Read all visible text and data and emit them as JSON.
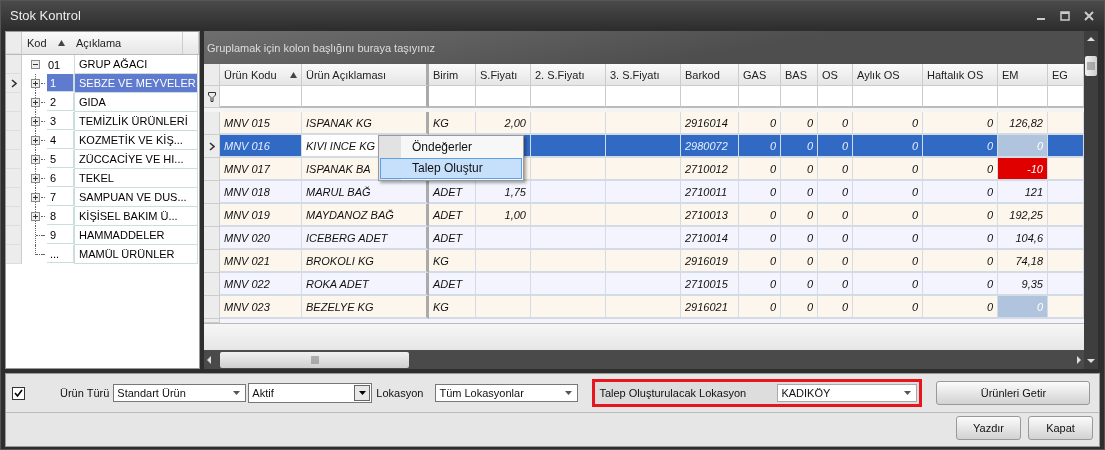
{
  "window": {
    "title": "Stok Kontrol"
  },
  "tree": {
    "columns": [
      "Kod",
      "Açıklama"
    ],
    "root": {
      "code": "01",
      "label": "GRUP AĞACI",
      "expanded": true,
      "selected": false,
      "children": [
        {
          "code": "1",
          "label": "SEBZE VE MEYVELER",
          "kind": "folder",
          "selected": true
        },
        {
          "code": "2",
          "label": "GIDA",
          "kind": "folder",
          "selected": false
        },
        {
          "code": "3",
          "label": "TEMİZLİK ÜRÜNLERİ",
          "kind": "folder",
          "selected": false
        },
        {
          "code": "4",
          "label": "KOZMETİK VE KİŞ...",
          "kind": "folder",
          "selected": false
        },
        {
          "code": "5",
          "label": "ZÜCCACİYE VE HI...",
          "kind": "folder",
          "selected": false
        },
        {
          "code": "6",
          "label": "TEKEL",
          "kind": "folder",
          "selected": false
        },
        {
          "code": "7",
          "label": "SAMPUAN VE DUS...",
          "kind": "folder",
          "selected": false
        },
        {
          "code": "8",
          "label": "KİŞİSEL BAKIM Ü...",
          "kind": "folder",
          "selected": false
        },
        {
          "code": "9",
          "label": "HAMMADDELER",
          "kind": "leaf",
          "selected": false
        },
        {
          "code": "...",
          "label": "MAMÜL ÜRÜNLER",
          "kind": "leaf",
          "selected": false
        }
      ]
    }
  },
  "grid": {
    "group_hint": "Gruplamak için kolon başlığını buraya taşıyınız",
    "columns": [
      "Ürün Kodu",
      "Ürün Açıklaması",
      "Birim",
      "S.Fiyatı",
      "2. S.Fiyatı",
      "3. S.Fiyatı",
      "Barkod",
      "GAS",
      "BAS",
      "OS",
      "Aylık OS",
      "Haftalık OS",
      "EM",
      "EG"
    ],
    "rows": [
      {
        "cells": [
          "MNV 015",
          "ISPANAK  KG",
          "KG",
          "2,00",
          "",
          "",
          "2916014",
          "0",
          "0",
          "0",
          "0",
          "0",
          "126,82",
          ""
        ],
        "selected": false,
        "em_empty": false,
        "em_negative": false
      },
      {
        "cells": [
          "MNV 016",
          "KIVI INCE KG",
          "",
          "",
          "",
          "",
          "2980072",
          "0",
          "0",
          "0",
          "0",
          "0",
          "0",
          ""
        ],
        "selected": true,
        "em_empty": true,
        "em_negative": false
      },
      {
        "cells": [
          "MNV 017",
          "ISPANAK BA",
          "",
          "",
          "",
          "",
          "2710012",
          "0",
          "0",
          "0",
          "0",
          "0",
          "-10",
          ""
        ],
        "selected": false,
        "em_empty": false,
        "em_negative": true
      },
      {
        "cells": [
          "MNV 018",
          "MARUL BAĞ",
          "ADET",
          "1,75",
          "",
          "",
          "2710011",
          "0",
          "0",
          "0",
          "0",
          "0",
          "121",
          ""
        ],
        "selected": false,
        "em_empty": false,
        "em_negative": false
      },
      {
        "cells": [
          "MNV 019",
          "MAYDANOZ BAĞ",
          "ADET",
          "1,00",
          "",
          "",
          "2710013",
          "0",
          "0",
          "0",
          "0",
          "0",
          "192,25",
          ""
        ],
        "selected": false,
        "em_empty": false,
        "em_negative": false
      },
      {
        "cells": [
          "MNV 020",
          "ICEBERG ADET",
          "ADET",
          "",
          "",
          "",
          "2710014",
          "0",
          "0",
          "0",
          "0",
          "0",
          "104,6",
          ""
        ],
        "selected": false,
        "em_empty": false,
        "em_negative": false
      },
      {
        "cells": [
          "MNV 021",
          "BROKOLI KG",
          "KG",
          "",
          "",
          "",
          "2916019",
          "0",
          "0",
          "0",
          "0",
          "0",
          "74,18",
          ""
        ],
        "selected": false,
        "em_empty": false,
        "em_negative": false
      },
      {
        "cells": [
          "MNV 022",
          "ROKA ADET",
          "ADET",
          "",
          "",
          "",
          "2710015",
          "0",
          "0",
          "0",
          "0",
          "0",
          "9,35",
          ""
        ],
        "selected": false,
        "em_empty": false,
        "em_negative": false
      },
      {
        "cells": [
          "MNV 023",
          "BEZELYE  KG",
          "KG",
          "",
          "",
          "",
          "2916021",
          "0",
          "0",
          "0",
          "0",
          "0",
          "0",
          ""
        ],
        "selected": false,
        "em_empty": true,
        "em_negative": false
      }
    ],
    "context_menu": [
      {
        "label": "Öndeğerler",
        "selected": false
      },
      {
        "label": "Talep Oluştur",
        "selected": true
      }
    ]
  },
  "filters": {
    "active_checkbox": {
      "checked": true
    },
    "product_type": {
      "label": "Ürün Türü",
      "value": "Standart Ürün"
    },
    "status": {
      "value": "Aktif"
    },
    "location": {
      "label": "Lokasyon",
      "value": "Tüm Lokasyonlar"
    },
    "request_location": {
      "label": "Talep Oluşturulacak Lokasyon",
      "value": "KADIKÖY",
      "highlighted": true
    }
  },
  "buttons": [
    "Ürünleri Getir",
    "Yazdır",
    "Kapat"
  ]
}
